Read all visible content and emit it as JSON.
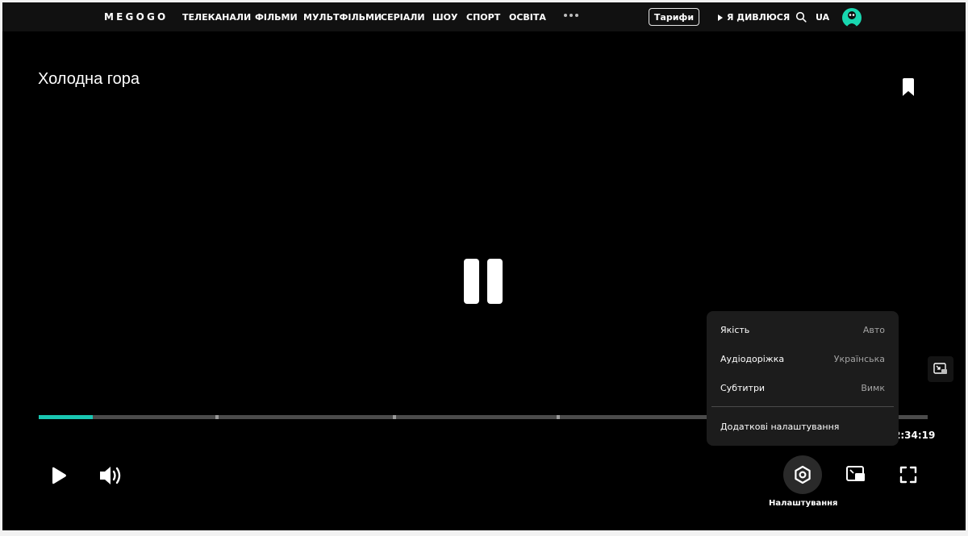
{
  "nav": {
    "logo": "MEGOGO",
    "items": [
      "ТЕЛЕКАНАЛИ",
      "ФІЛЬМИ",
      "МУЛЬТФІЛЬМИ",
      "СЕРІАЛИ",
      "ШОУ",
      "СПОРТ",
      "ОСВІТА"
    ],
    "tariffs": "Тарифи",
    "watching": "Я ДИВЛЮСЯ",
    "lang": "UA"
  },
  "player": {
    "title": "Холодна гора",
    "time": "2:34:19",
    "progress_fraction": 0.061,
    "chapter_marks_fraction": [
      0.199,
      0.398,
      0.583,
      0.764
    ],
    "accent_color": "#19c7b2",
    "settings_label": "Налаштування"
  },
  "menu": {
    "quality_label": "Якість",
    "quality_value": "Авто",
    "audio_label": "Аудіодоріжка",
    "audio_value": "Українська",
    "subtitles_label": "Субтитри",
    "subtitles_value": "Вимк",
    "advanced_label": "Додаткові налаштування"
  },
  "icons": [
    "more-dots-icon",
    "search-icon",
    "avatar",
    "bookmark-icon",
    "pause-icon",
    "pip-icon",
    "play-icon",
    "volume-icon",
    "gear-icon",
    "miniplayer-icon",
    "fullscreen-icon"
  ]
}
